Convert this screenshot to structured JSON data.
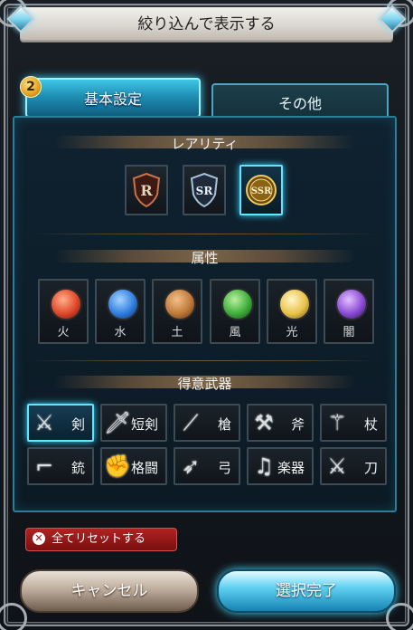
{
  "window": {
    "title": "絞り込んで表示する"
  },
  "tabs": [
    {
      "label": "基本設定",
      "active": true,
      "badge": "2"
    },
    {
      "label": "その他",
      "active": false
    }
  ],
  "rarity": {
    "heading": "レアリティ",
    "items": [
      {
        "label": "R",
        "selected": false,
        "color": "#b04030"
      },
      {
        "label": "SR",
        "selected": false,
        "color": "#8fa8c8"
      },
      {
        "label": "SSR",
        "selected": true,
        "color": "#e0b040"
      }
    ]
  },
  "element": {
    "heading": "属性",
    "items": [
      {
        "label": "火",
        "icon": "fire-element-icon",
        "color": "#e0482a"
      },
      {
        "label": "水",
        "icon": "water-element-icon",
        "color": "#2f7fe0"
      },
      {
        "label": "土",
        "icon": "earth-element-icon",
        "color": "#c07a3a"
      },
      {
        "label": "風",
        "icon": "wind-element-icon",
        "color": "#3fae3a"
      },
      {
        "label": "光",
        "icon": "light-element-icon",
        "color": "#e8c34a"
      },
      {
        "label": "闇",
        "icon": "dark-element-icon",
        "color": "#8b4bd6"
      }
    ]
  },
  "weapon": {
    "heading": "得意武器",
    "items": [
      {
        "label": "剣",
        "icon": "sword-icon",
        "selected": true
      },
      {
        "label": "短剣",
        "icon": "dagger-icon",
        "selected": false
      },
      {
        "label": "槍",
        "icon": "spear-icon",
        "selected": false
      },
      {
        "label": "斧",
        "icon": "axe-icon",
        "selected": false
      },
      {
        "label": "杖",
        "icon": "staff-icon",
        "selected": false
      },
      {
        "label": "銃",
        "icon": "gun-icon",
        "selected": false
      },
      {
        "label": "格闘",
        "icon": "fist-icon",
        "selected": false
      },
      {
        "label": "弓",
        "icon": "bow-icon",
        "selected": false
      },
      {
        "label": "楽器",
        "icon": "harp-icon",
        "selected": false
      },
      {
        "label": "刀",
        "icon": "katana-icon",
        "selected": false
      }
    ]
  },
  "reset_label": "全てリセットする",
  "footer": {
    "cancel_label": "キャンセル",
    "confirm_label": "選択完了"
  }
}
